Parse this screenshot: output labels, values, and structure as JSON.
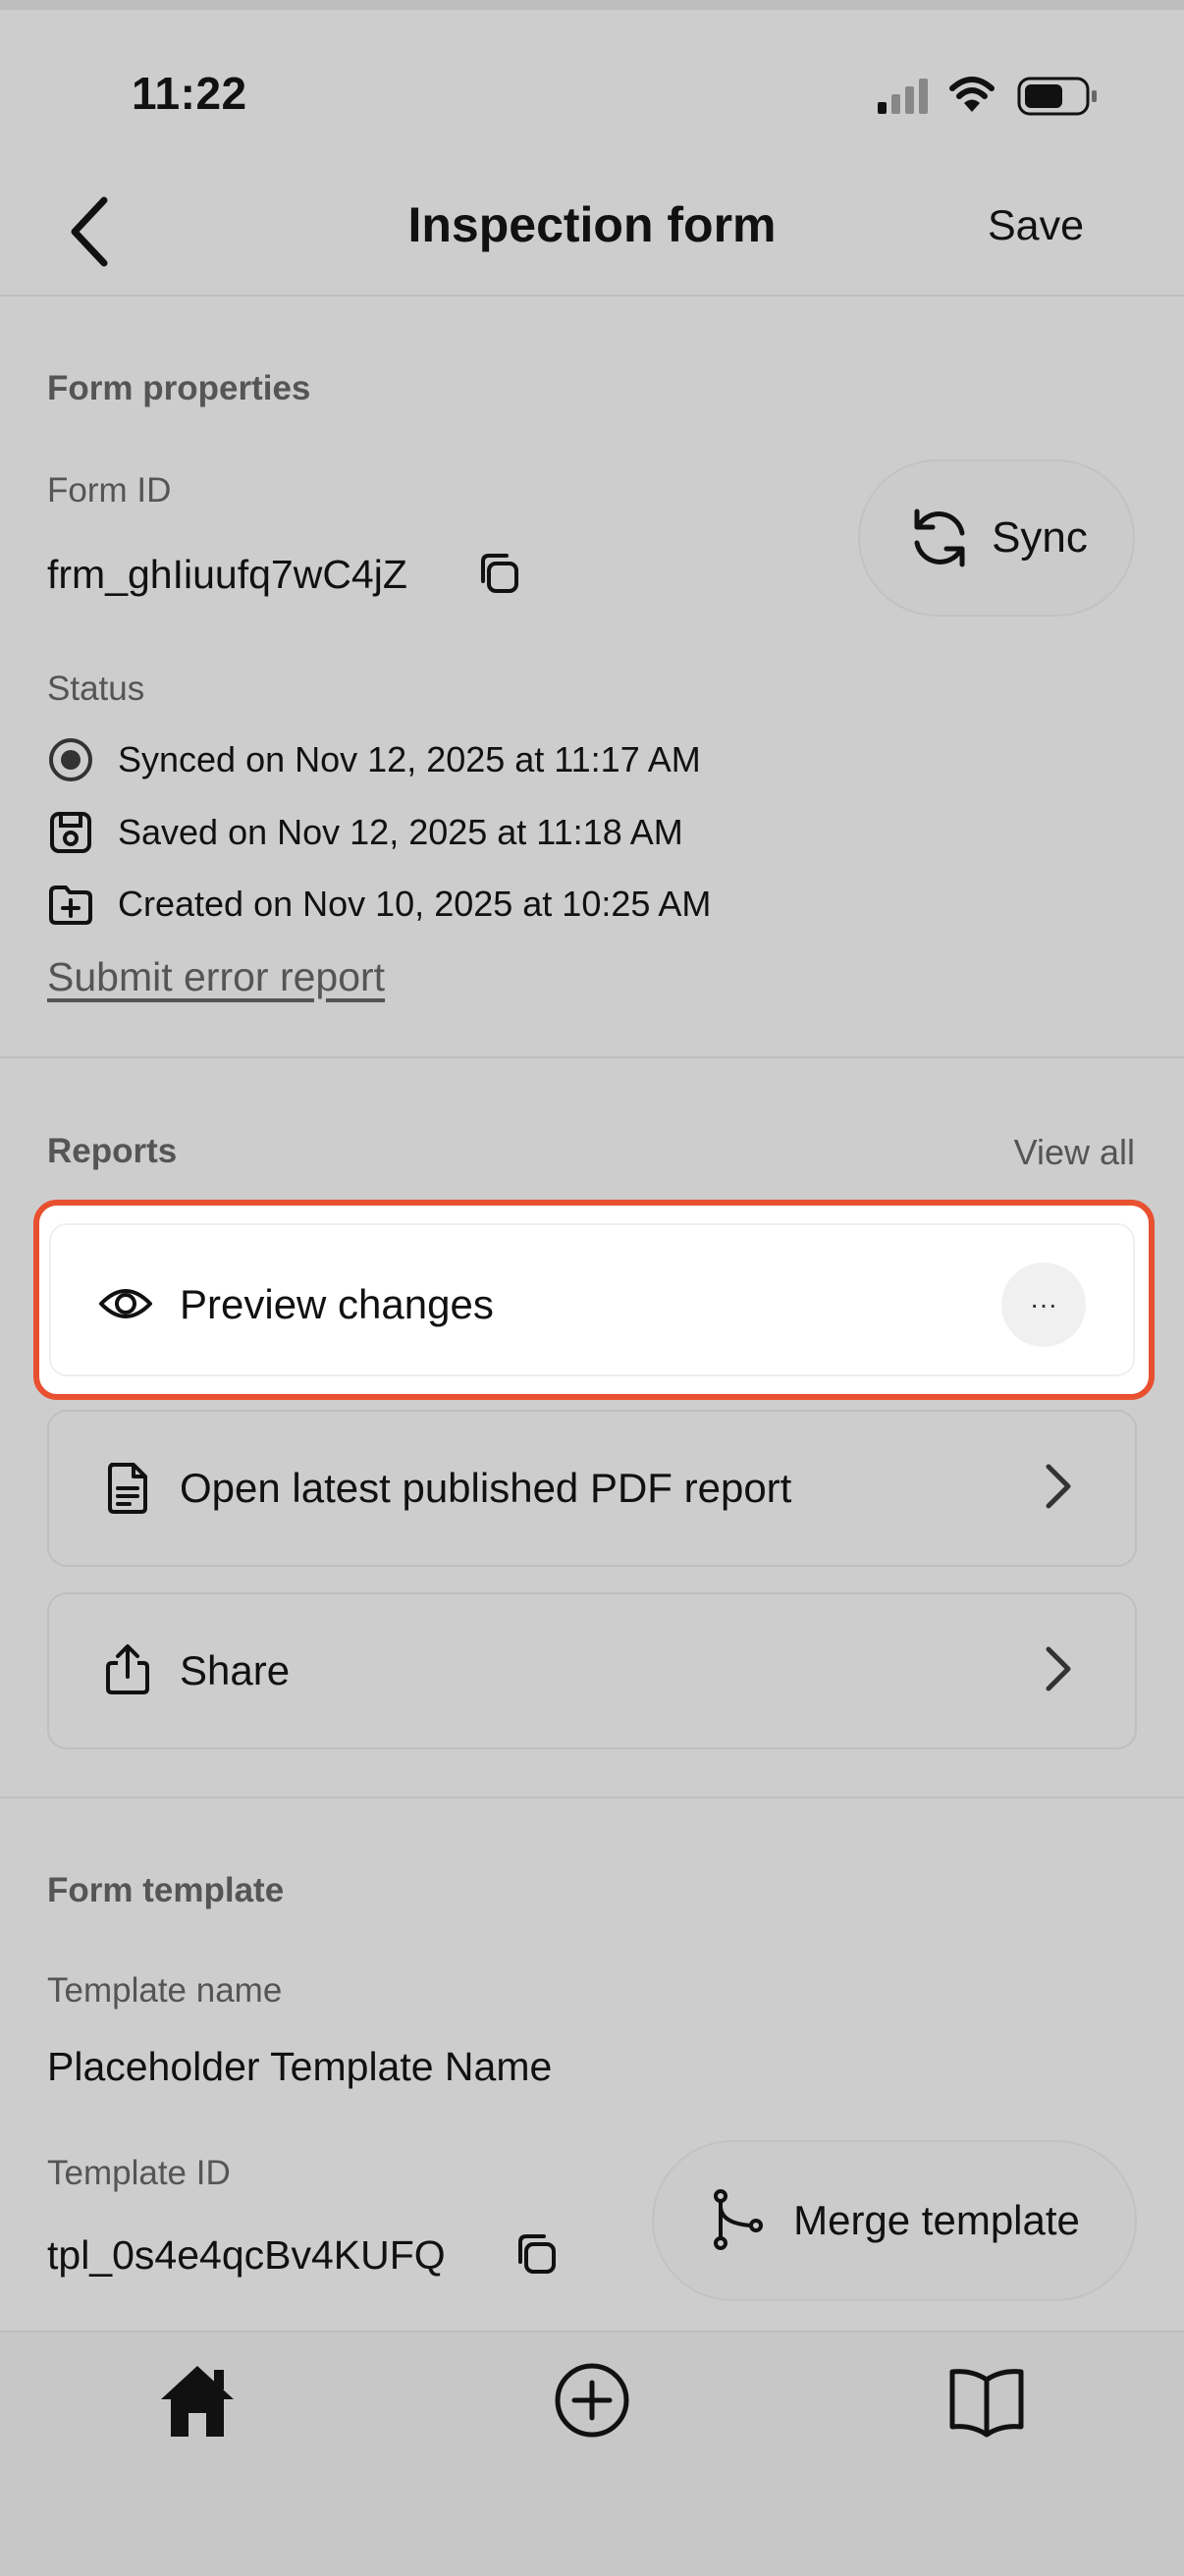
{
  "status_bar": {
    "time": "11:22"
  },
  "nav": {
    "title": "Inspection form",
    "save_label": "Save"
  },
  "form_properties": {
    "section_title": "Form properties",
    "form_id_label": "Form ID",
    "form_id_value": "frm_ghIiuufq7wC4jZ",
    "sync_label": "Sync",
    "status_label": "Status",
    "statuses": [
      {
        "icon": "radio-selected-icon",
        "text": "Synced on Nov 12, 2025 at 11:17 AM"
      },
      {
        "icon": "save-icon",
        "text": "Saved on Nov 12, 2025 at 11:18 AM"
      },
      {
        "icon": "folder-plus-icon",
        "text": "Created on Nov 10, 2025 at 10:25 AM"
      }
    ],
    "error_link": "Submit error report"
  },
  "reports": {
    "section_title": "Reports",
    "view_all": "View all",
    "items": [
      {
        "icon": "eye-icon",
        "label": "Preview changes",
        "more": "···"
      },
      {
        "icon": "document-icon",
        "label": "Open latest published PDF report"
      },
      {
        "icon": "share-icon",
        "label": "Share"
      }
    ]
  },
  "form_template": {
    "section_title": "Form template",
    "template_name_label": "Template name",
    "template_name_value": "Placeholder Template Name",
    "template_id_label": "Template ID",
    "template_id_value": "tpl_0s4e4qcBv4KUFQ",
    "merge_label": "Merge template"
  },
  "tabbar": {
    "items": [
      "home-icon",
      "add-circle-icon",
      "book-icon"
    ]
  },
  "colors": {
    "highlight": "#e8502f",
    "background": "#cdcdcd",
    "card": "#ffffff"
  }
}
